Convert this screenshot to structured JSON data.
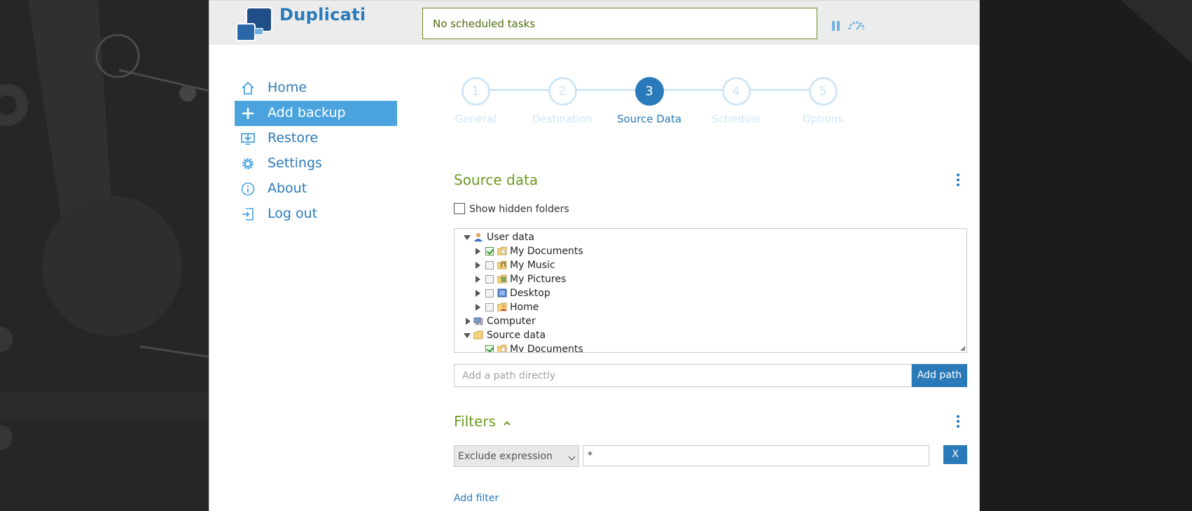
{
  "app": {
    "name": "Duplicati"
  },
  "header": {
    "status_text": "No scheduled tasks",
    "icons": [
      "pause-icon",
      "throttle-icon"
    ]
  },
  "sidebar": {
    "items": [
      {
        "label": "Home",
        "icon": "home-icon",
        "active": false
      },
      {
        "label": "Add backup",
        "icon": "plus-icon",
        "active": true
      },
      {
        "label": "Restore",
        "icon": "restore-icon",
        "active": false
      },
      {
        "label": "Settings",
        "icon": "gear-icon",
        "active": false
      },
      {
        "label": "About",
        "icon": "info-icon",
        "active": false
      },
      {
        "label": "Log out",
        "icon": "logout-icon",
        "active": false
      }
    ]
  },
  "wizard": {
    "current_step": 3,
    "steps": [
      {
        "number": "1",
        "label": "General"
      },
      {
        "number": "2",
        "label": "Destination"
      },
      {
        "number": "3",
        "label": "Source Data"
      },
      {
        "number": "4",
        "label": "Schedule"
      },
      {
        "number": "5",
        "label": "Options"
      }
    ]
  },
  "source": {
    "title": "Source data",
    "show_hidden_label": "Show hidden folders",
    "show_hidden_checked": false,
    "tree": [
      {
        "label": "User data",
        "level": 0,
        "expanded": true,
        "checkbox": false,
        "checked": false,
        "icon": "user-icon"
      },
      {
        "label": "My Documents",
        "level": 1,
        "expanded": false,
        "checkbox": true,
        "checked": true,
        "icon": "documents-folder-icon"
      },
      {
        "label": "My Music",
        "level": 1,
        "expanded": false,
        "checkbox": true,
        "checked": false,
        "icon": "music-folder-icon"
      },
      {
        "label": "My Pictures",
        "level": 1,
        "expanded": false,
        "checkbox": true,
        "checked": false,
        "icon": "pictures-folder-icon"
      },
      {
        "label": "Desktop",
        "level": 1,
        "expanded": false,
        "checkbox": true,
        "checked": false,
        "icon": "desktop-icon"
      },
      {
        "label": "Home",
        "level": 1,
        "expanded": false,
        "checkbox": true,
        "checked": false,
        "icon": "home-folder-icon"
      },
      {
        "label": "Computer",
        "level": 0,
        "expanded": false,
        "checkbox": false,
        "checked": false,
        "icon": "computer-icon"
      },
      {
        "label": "Source data",
        "level": 0,
        "expanded": true,
        "checkbox": false,
        "checked": false,
        "icon": "folder-icon"
      },
      {
        "label": "My Documents",
        "level": 1,
        "expanded": false,
        "checkbox": true,
        "checked": true,
        "icon": "documents-folder-icon"
      }
    ],
    "path_placeholder": "Add a path directly",
    "add_path_label": "Add path"
  },
  "filters": {
    "title": "Filters",
    "type_selected": "Exclude expression",
    "value": "*",
    "remove_label": "X",
    "add_filter_label": "Add filter"
  },
  "colors": {
    "accent": "#2a7ab9",
    "active_nav": "#4aa3dd",
    "section_green": "#6b9a1f",
    "inactive_step": "#cfe6f6"
  }
}
